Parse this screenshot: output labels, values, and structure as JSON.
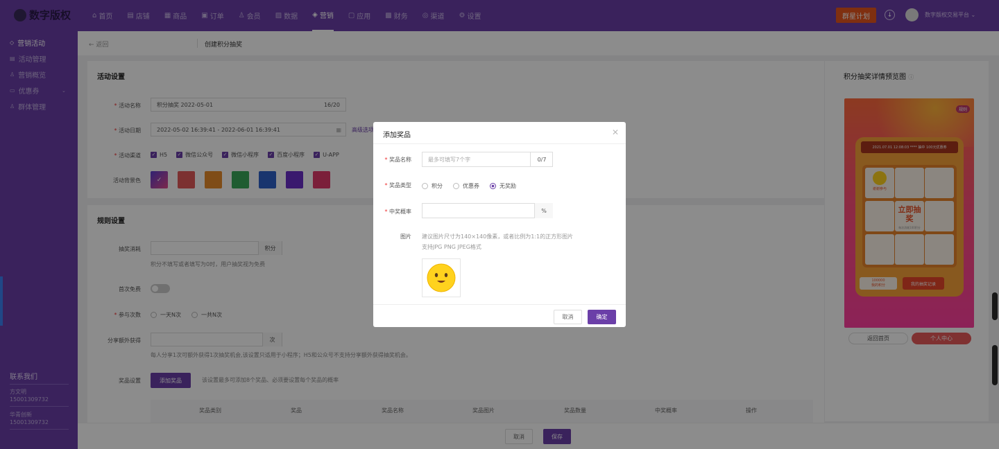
{
  "header": {
    "logo": "数字版权",
    "nav": [
      {
        "label": "首页",
        "icon": "home-icon",
        "glyph": "⌂"
      },
      {
        "label": "店铺",
        "icon": "shop-icon",
        "glyph": "▤"
      },
      {
        "label": "商品",
        "icon": "goods-icon",
        "glyph": "▦"
      },
      {
        "label": "订单",
        "icon": "order-icon",
        "glyph": "▣"
      },
      {
        "label": "会员",
        "icon": "member-icon",
        "glyph": "♙"
      },
      {
        "label": "数据",
        "icon": "data-icon",
        "glyph": "▨"
      },
      {
        "label": "营销",
        "icon": "tag-icon",
        "glyph": "◈"
      },
      {
        "label": "应用",
        "icon": "app-icon",
        "glyph": "▢"
      },
      {
        "label": "财务",
        "icon": "finance-icon",
        "glyph": "▩"
      },
      {
        "label": "渠道",
        "icon": "channel-icon",
        "glyph": "◎"
      },
      {
        "label": "设置",
        "icon": "gear-icon",
        "glyph": "⚙"
      }
    ],
    "promo_button": "群星计划",
    "user_name": "数字版权交易平台 ⌄"
  },
  "sidebar": {
    "items": [
      {
        "label": "营销活动",
        "icon": "tag-icon",
        "glyph": "◇"
      },
      {
        "label": "活动管理",
        "icon": "list-icon",
        "glyph": "▤"
      },
      {
        "label": "营销概览",
        "icon": "person-icon",
        "glyph": "♙"
      },
      {
        "label": "优惠券",
        "icon": "coupon-icon",
        "glyph": "▭"
      },
      {
        "label": "群体管理",
        "icon": "group-icon",
        "glyph": "♙"
      }
    ],
    "contact_title": "联系我们",
    "contacts": [
      {
        "name": "方文明",
        "phone": "15001309732"
      },
      {
        "name": "华青创新",
        "phone": "15001309732"
      }
    ]
  },
  "breadcrumb": {
    "back": "← 返回",
    "current": "创建积分抽奖"
  },
  "activity": {
    "title": "活动设置",
    "name_label": "活动名称",
    "name_value": "积分抽奖  2022-05-01",
    "name_count": "16/20",
    "date_label": "活动日期",
    "date_value": "2022-05-02 16:39:41  -  2022-06-01 16:39:41",
    "advanced": "高级选项",
    "channel_label": "活动渠道",
    "channels": [
      "H5",
      "微信公众号",
      "微信小程序",
      "百度小程序",
      "U-APP"
    ],
    "bg_label": "活动背景色",
    "colors": [
      "#7b4fd0",
      "#e25a5a",
      "#e88a2a",
      "#3aa85a",
      "#2e62c8",
      "#6a2ec8",
      "#e03a6a"
    ]
  },
  "rules": {
    "title": "规则设置",
    "cost_label": "抽奖消耗",
    "cost_unit": "积分",
    "cost_hint": "积分不填写或者填写为0时，用户抽奖视为免费",
    "first_free_label": "首次免费",
    "times_label": "参与次数",
    "times_options": [
      "一天N次",
      "一共N次"
    ],
    "share_label": "分享额外获得",
    "share_unit": "次",
    "share_hint": "每人分享1次可额外获得1次抽奖机会,该设置只适用于小程序；H5和公众号不支持分享额外获得抽奖机会。",
    "prize_label": "奖品设置",
    "add_prize_button": "添加奖品",
    "prize_hint": "该设置最多可添加8个奖品、必须要设置每个奖品的概率",
    "table_headers": [
      "奖品类别",
      "奖品",
      "奖品名称",
      "奖品图片",
      "奖品数量",
      "中奖概率",
      "操作"
    ]
  },
  "footer": {
    "cancel": "取消",
    "save": "保存"
  },
  "preview": {
    "title": "积分抽奖详情预览图",
    "help_icon": "ⓘ",
    "banner": "2021.07.01 12:08:03 **** 抽中 100元优惠券",
    "rules_tag": "规则",
    "center_text": "立即抽奖",
    "center_sub": "每次消耗100积分",
    "thanks": "谢谢参与",
    "points": "100000",
    "points_label": "我的积分",
    "records": "我的抽奖记录",
    "home_button": "返回首页",
    "center_button": "个人中心"
  },
  "modal": {
    "title": "添加奖品",
    "name_label": "奖品名称",
    "name_placeholder": "最多可填写7个字",
    "name_count": "0/7",
    "type_label": "奖品类型",
    "type_options": [
      "积分",
      "优惠券",
      "无奖励"
    ],
    "type_selected": "无奖励",
    "prob_label": "中奖概率",
    "prob_unit": "%",
    "image_label": "图片",
    "image_hint1": "建议图片尺寸为140×140像素，或者比例为1:1的正方形图片",
    "image_hint2": "支持JPG PNG JPEG格式",
    "cancel": "取消",
    "confirm": "确定"
  },
  "colors": {
    "brand": "#6b3fa8",
    "promo": "#e8561e"
  }
}
